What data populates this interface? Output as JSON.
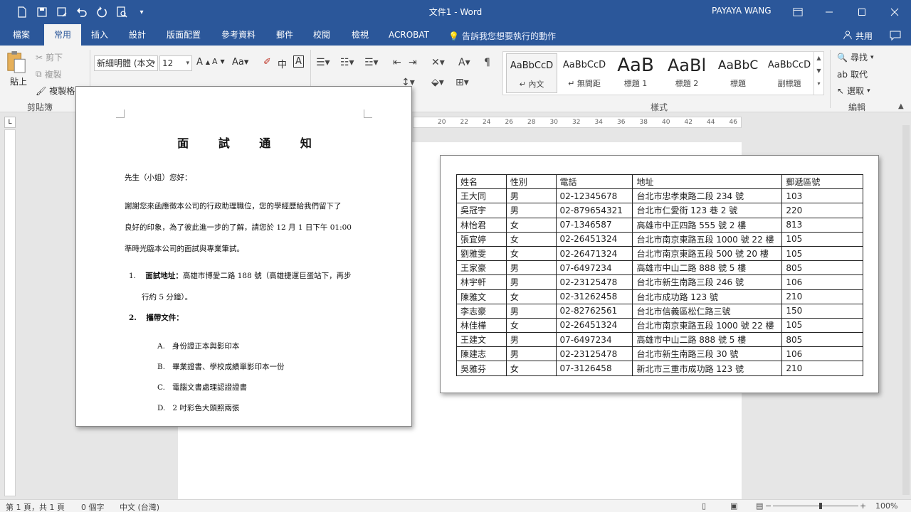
{
  "titlebar": {
    "title": "文件1 - Word",
    "user": "PAYAYA WANG"
  },
  "tabs": [
    "檔案",
    "常用",
    "插入",
    "設計",
    "版面配置",
    "參考資料",
    "郵件",
    "校閱",
    "檢視",
    "ACROBAT"
  ],
  "active_tab": "常用",
  "tell_me": "告訴我您想要執行的動作",
  "share": "共用",
  "ribbon": {
    "clipboard": {
      "paste": "貼上",
      "cut": "剪下",
      "copy": "複製",
      "format_painter": "複製格",
      "label": "剪貼簿"
    },
    "font": {
      "name": "新細明體 (本文",
      "size": "12"
    },
    "styles": {
      "label": "樣式",
      "items": [
        {
          "sample": "AaBbCcD",
          "name": "↵ 內文"
        },
        {
          "sample": "AaBbCcD",
          "name": "↵ 無間距"
        },
        {
          "sample": "AaB",
          "name": "標題 1"
        },
        {
          "sample": "AaBl",
          "name": "標題 2"
        },
        {
          "sample": "AaBbC",
          "name": "標題"
        },
        {
          "sample": "AaBbCcD",
          "name": "副標題"
        }
      ]
    },
    "editing": {
      "find": "尋找",
      "replace": "取代",
      "select": "選取",
      "label": "編輯"
    }
  },
  "ruler_ticks": [
    "20",
    "22",
    "24",
    "26",
    "28",
    "30",
    "32",
    "34",
    "36",
    "38",
    "40",
    "42",
    "44",
    "46"
  ],
  "notice": {
    "title": "面 試 通 知",
    "greeting": "先生（小姐）您好：",
    "para1": "謝謝您來函應徵本公司的行政助理職位，您的學經歷給我們留下了",
    "para2": "良好的印象，為了彼此進一步的了解，請您於 12 月 1 日下午 01:00",
    "para3": "準時光臨本公司的面試與專業筆試。",
    "item1_num": "1.",
    "item1_label": "面試地址：",
    "item1_text": "高雄市博愛二路 188 號（高雄捷運巨蛋站下，再步",
    "item1_text2": "行約 5 分鐘）。",
    "item2_num": "2.",
    "item2_label": "攜帶文件：",
    "subitems": [
      {
        "letter": "A.",
        "text": "身份證正本與影印本"
      },
      {
        "letter": "B.",
        "text": "畢業證書、學校成績單影印本一份"
      },
      {
        "letter": "C.",
        "text": "電腦文書處理認證證書"
      },
      {
        "letter": "D.",
        "text": "2 吋彩色大頭照兩張"
      }
    ]
  },
  "table": {
    "headers": [
      "姓名",
      "性別",
      "電話",
      "地址",
      "郵遞區號"
    ],
    "rows": [
      [
        "王大同",
        "男",
        "02-12345678",
        "台北市忠孝東路二段 234 號",
        "103"
      ],
      [
        "吳冠宇",
        "男",
        "02-879654321",
        "台北市仁愛街 123 巷 2 號",
        "220"
      ],
      [
        "林怡君",
        "女",
        "07-1346587",
        "高雄市中正四路 555 號 2 樓",
        "813"
      ],
      [
        "張宜婷",
        "女",
        "02-26451324",
        "台北市南京東路五段 1000 號 22 樓",
        "105"
      ],
      [
        "劉雅雯",
        "女",
        "02-26471324",
        "台北市南京東路五段 500 號 20 樓",
        "105"
      ],
      [
        "王家豪",
        "男",
        "07-6497234",
        "高雄市中山二路 888 號 5 樓",
        "805"
      ],
      [
        "林宇軒",
        "男",
        "02-23125478",
        "台北市新生南路三段 246 號",
        "106"
      ],
      [
        "陳雅文",
        "女",
        "02-31262458",
        "台北市成功路 123 號",
        "210"
      ],
      [
        "李志豪",
        "男",
        "02-82762561",
        "台北市信義區松仁路三號",
        "150"
      ],
      [
        "林佳樺",
        "女",
        "02-26451324",
        "台北市南京東路五段 1000 號 22 樓",
        "105"
      ],
      [
        "王建文",
        "男",
        "07-6497234",
        "高雄市中山二路 888 號 5 樓",
        "805"
      ],
      [
        "陳建志",
        "男",
        "02-23125478",
        "台北市新生南路三段 30 號",
        "106"
      ],
      [
        "吳雅芬",
        "女",
        "07-3126458",
        "新北市三重市成功路 123 號",
        "210"
      ]
    ]
  },
  "status": {
    "page": "第 1 頁，共 1 頁",
    "words": "0 個字",
    "language": "中文 (台灣)",
    "zoom": "100%"
  },
  "colors": {
    "accent": "#2b579a"
  }
}
